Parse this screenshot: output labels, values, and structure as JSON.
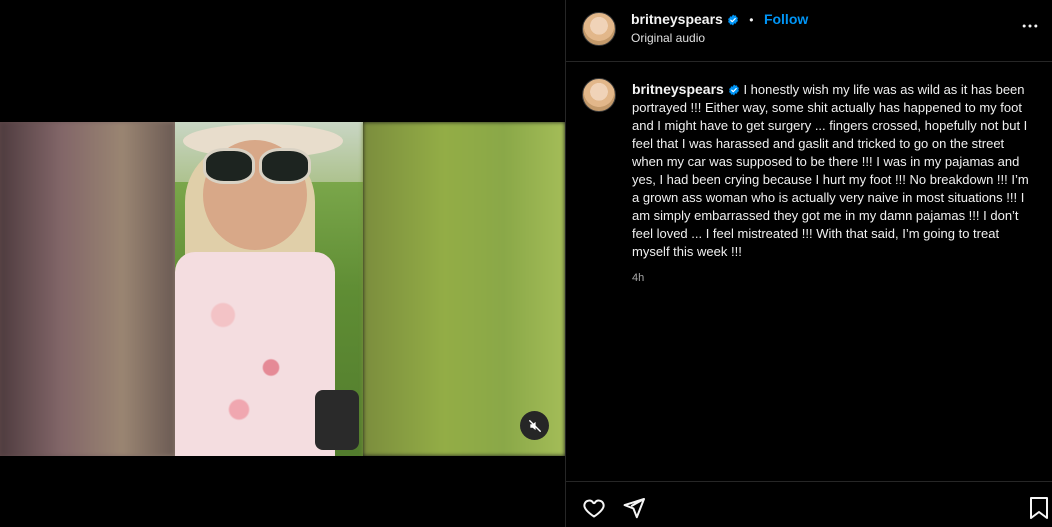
{
  "post": {
    "username": "britneyspears",
    "separator": "•",
    "follow_label": "Follow",
    "audio_label": "Original audio",
    "caption": "I honestly wish my life was as wild as it has been portrayed !!! Either way, some shit actually has happened to my foot and I might have to get surgery ... fingers crossed, hopefully not but I feel that I was harassed and gaslit and tricked to go on the street when my car was supposed to be there !!! I was in my pajamas and yes, I had been crying because I hurt my foot !!! No breakdown !!! I’m a grown ass woman who is actually very naive in most situations !!! I am simply embarrassed they got me in my damn pajamas !!! I don’t feel loved ... I feel mistreated !!! With that said, I’m going to treat myself this week !!!",
    "timestamp": "4h"
  },
  "icons": {
    "verified": "verified-badge-icon",
    "more": "more-options-icon",
    "mute": "muted-speaker-icon",
    "like": "heart-icon",
    "share": "paper-plane-icon",
    "save": "bookmark-icon"
  },
  "colors": {
    "background": "#000000",
    "accent": "#0095f6",
    "divider": "#262626"
  }
}
